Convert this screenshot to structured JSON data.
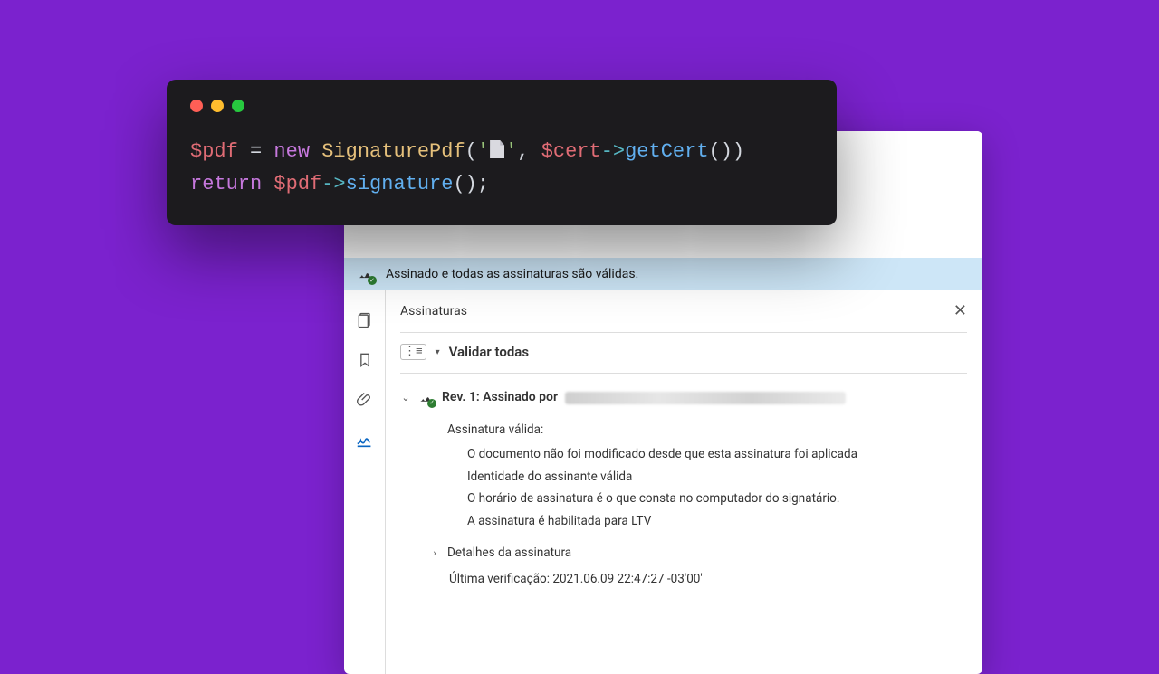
{
  "colors": {
    "bg": "#7b22ce",
    "code_bg": "#1c1b1e",
    "status_bg": "#cde6f7",
    "ok_badge": "#2e7d32",
    "active_icon": "#0a66c2"
  },
  "code": {
    "line1": {
      "var": "$pdf",
      "op1": " = ",
      "kw": "new",
      "cls": " SignaturePdf",
      "open": "(",
      "strq1": "'",
      "icon_name": "file-icon",
      "strq2": "'",
      "comma": ", ",
      "var2": "$cert",
      "arrow": "->",
      "fn": "getCert",
      "close": "())"
    },
    "line2": {
      "kw": "return",
      "sp": " ",
      "var": "$pdf",
      "arrow": "->",
      "fn": "signature",
      "close": "();"
    }
  },
  "pdf": {
    "status": "Assinado e todas as assinaturas são válidas.",
    "panel_title": "Assinaturas",
    "validate_all": "Validar todas",
    "rev_label": "Rev. 1: Assinado por",
    "valid_heading": "Assinatura válida:",
    "points": [
      "O documento não foi modificado desde que esta assinatura foi aplicada",
      "Identidade do assinante válida",
      "O horário de assinatura é o que consta no computador do signatário.",
      "A assinatura é habilitada para LTV"
    ],
    "details_label": "Detalhes da assinatura",
    "last_check": "Última verificação: 2021.06.09 22:47:27 -03'00'"
  }
}
